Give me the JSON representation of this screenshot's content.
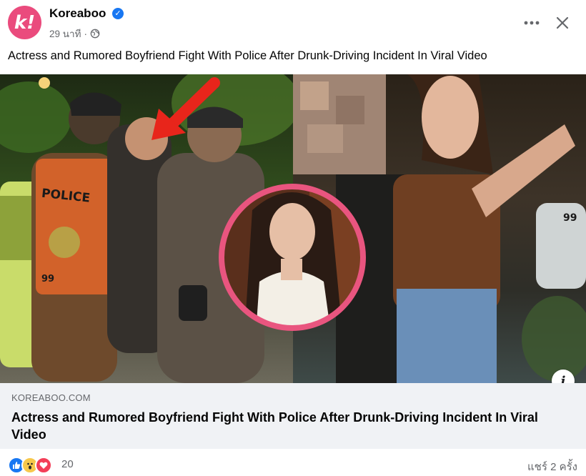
{
  "header": {
    "page_name": "Koreaboo",
    "avatar_glyph": "k!",
    "time": "29 นาที",
    "separator": "·"
  },
  "caption": "Actress and Rumored Boyfriend Fight With Police After Drunk-Driving Incident In Viral Video",
  "link": {
    "domain": "KOREABOO.COM",
    "title": "Actress and Rumored Boyfriend Fight With Police After Drunk-Driving Incident In Viral Video"
  },
  "photo_text": {
    "police_vest": "POLICE",
    "car_number": "99"
  },
  "footer": {
    "reaction_count": "20",
    "shares": "แชร์ 2 ครั้ง",
    "reactions": [
      "like-icon",
      "wow-icon",
      "love-icon"
    ]
  },
  "colors": {
    "brand": "#ea4b7d",
    "verified": "#1877f2",
    "arrow": "#e8251b",
    "circle_border": "#e9557f"
  }
}
